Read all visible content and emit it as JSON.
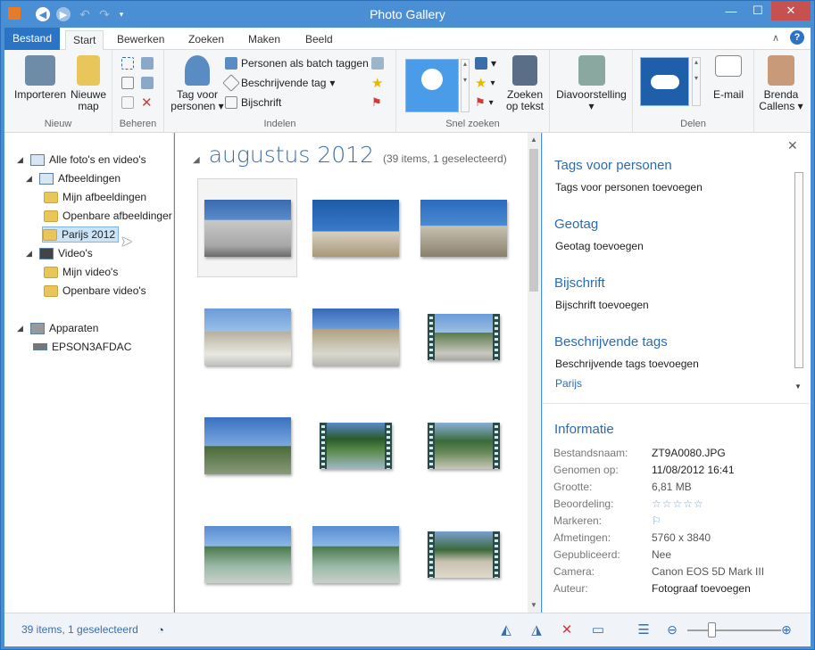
{
  "window": {
    "title": "Photo Gallery"
  },
  "ribbon": {
    "tabs": [
      {
        "label": "Bestand"
      },
      {
        "label": "Start"
      },
      {
        "label": "Bewerken"
      },
      {
        "label": "Zoeken"
      },
      {
        "label": "Maken"
      },
      {
        "label": "Beeld"
      }
    ],
    "groups": {
      "nieuw": {
        "label": "Nieuw",
        "importeren": "Importeren",
        "nieuwe_map_1": "Nieuwe",
        "nieuwe_map_2": "map"
      },
      "beheren": {
        "label": "Beheren"
      },
      "indelen": {
        "label": "Indelen",
        "tag_voor_1": "Tag voor",
        "tag_voor_2": "personen",
        "batch": "Personen als batch taggen",
        "beschrijvende": "Beschrijvende tag",
        "bijschrift": "Bijschrift"
      },
      "snel_zoeken": {
        "label": "Snel zoeken",
        "zoeken_op_1": "Zoeken",
        "zoeken_op_2": "op tekst"
      },
      "diavoorstelling": {
        "label": "Diavoorstelling"
      },
      "delen": {
        "label": "Delen",
        "email": "E-mail"
      },
      "user": {
        "name_1": "Brenda",
        "name_2": "Callens"
      }
    }
  },
  "nav": {
    "alle": "Alle foto's en video's",
    "afbeeldingen": "Afbeeldingen",
    "mijn_afbeeldingen": "Mijn afbeeldingen",
    "openbare_afbeeldingen": "Openbare afbeeldinger",
    "parijs": "Parijs 2012",
    "videos": "Video's",
    "mijn_videos": "Mijn video's",
    "openbare_videos": "Openbare video's",
    "apparaten": "Apparaten",
    "epson": "EPSON3AFDAC"
  },
  "content": {
    "month": "augustus 2012",
    "count": "(39 items, 1 geselecteerd)"
  },
  "info": {
    "tags_personen": {
      "header": "Tags voor personen",
      "action": "Tags voor personen toevoegen"
    },
    "geotag": {
      "header": "Geotag",
      "action": "Geotag toevoegen"
    },
    "bijschrift": {
      "header": "Bijschrift",
      "action": "Bijschrift toevoegen"
    },
    "beschrijvende_tags": {
      "header": "Beschrijvende tags",
      "action": "Beschrijvende tags toevoegen",
      "tag": "Parijs"
    },
    "informatie": {
      "header": "Informatie",
      "rows": [
        {
          "k": "Bestandsnaam:",
          "v": "ZT9A0080.JPG"
        },
        {
          "k": "Genomen op:",
          "v": "11/08/2012  16:41"
        },
        {
          "k": "Grootte:",
          "v": "6,81 MB"
        },
        {
          "k": "Beoordeling:",
          "v": "☆☆☆☆☆"
        },
        {
          "k": "Markeren:",
          "v": "⚐"
        },
        {
          "k": "Afmetingen:",
          "v": "5760 x 3840"
        },
        {
          "k": "Gepubliceerd:",
          "v": "Nee"
        },
        {
          "k": "Camera:",
          "v": "Canon EOS 5D Mark III"
        },
        {
          "k": "Auteur:",
          "v": "Fotograaf toevoegen"
        }
      ]
    }
  },
  "status": {
    "text": "39 items, 1 geselecteerd"
  },
  "colors": {
    "accent": "#2b73c4",
    "title_bar": "#4a8fd4",
    "link": "#2a6cb0"
  }
}
